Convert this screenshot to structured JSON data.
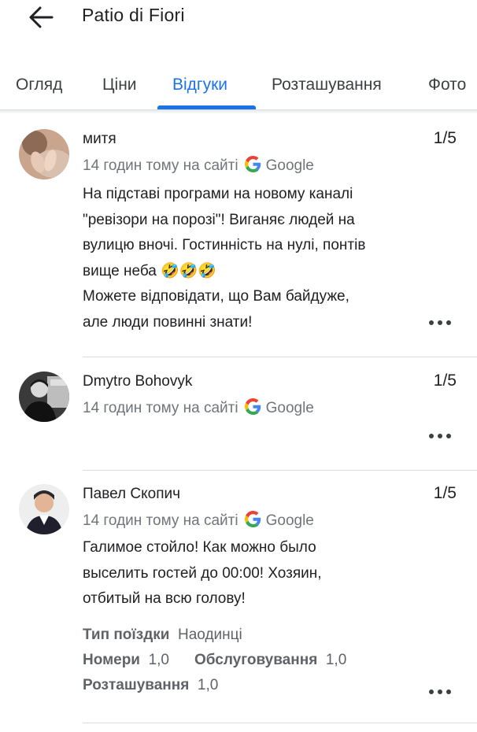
{
  "header": {
    "back_icon": "arrow-back-icon",
    "title": "Patio di Fiori"
  },
  "tabs": [
    {
      "label": "Огляд"
    },
    {
      "label": "Ціни"
    },
    {
      "label": "Відгуки",
      "active": true
    },
    {
      "label": "Розташування"
    },
    {
      "label": "Фото"
    }
  ],
  "colors": {
    "accent": "#1a73e8",
    "text": "#202124",
    "secondary": "#70757a",
    "divider": "#dadce0"
  },
  "reviews": [
    {
      "author": "митя",
      "rating": "1/5",
      "time": "14 годин тому на сайті",
      "source": "Google",
      "text_lines": [
        "На підставі програми на новому каналі",
        "\"ревізори на порозі\"! Виганяє людей на",
        "вулицю вночі. Гостинність на нулі, понтів",
        "вище неба 🤣🤣🤣",
        "Можете відповідати, що Вам байдуже,",
        "але люди повинні знати!"
      ]
    },
    {
      "author": "Dmytro Bohovyk",
      "rating": "1/5",
      "time": "14 годин тому на сайті",
      "source": "Google"
    },
    {
      "author": "Павел Скопич",
      "rating": "1/5",
      "time": "14 годин тому на сайті",
      "source": "Google",
      "text_lines": [
        "Галимое стойло! Как можно было",
        "выселить гостей до 00:00! Хозяин,",
        "отбитый на всю голову!"
      ],
      "details": {
        "trip_type_label": "Тип поїздки",
        "trip_type_value": "Наодинці",
        "rooms_label": "Номери",
        "rooms_value": "1,0",
        "service_label": "Обслуговування",
        "service_value": "1,0",
        "location_label": "Розташування",
        "location_value": "1,0"
      }
    }
  ]
}
